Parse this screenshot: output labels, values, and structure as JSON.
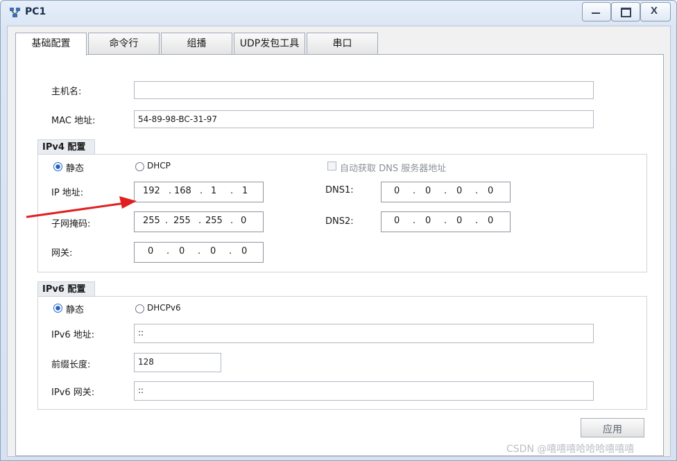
{
  "window": {
    "title": "PC1",
    "controls": {
      "minimize": "—",
      "maximize": "▭",
      "close": "X"
    }
  },
  "tabs": [
    "基础配置",
    "命令行",
    "组播",
    "UDP发包工具",
    "串口"
  ],
  "active_tab": "基础配置",
  "host": {
    "hostname_label": "主机名:",
    "hostname_value": "",
    "mac_label": "MAC 地址:",
    "mac_value": "54-89-98-BC-31-97"
  },
  "ipv4": {
    "title": "IPv4 配置",
    "static_label": "静态",
    "dhcp_label": "DHCP",
    "auto_dns_label": "自动获取 DNS 服务器地址",
    "ip_label": "IP 地址:",
    "ip": [
      "192",
      "168",
      "1",
      "1"
    ],
    "mask_label": "子网掩码:",
    "mask": [
      "255",
      "255",
      "255",
      "0"
    ],
    "gateway_label": "网关:",
    "gateway": [
      "0",
      "0",
      "0",
      "0"
    ],
    "dns1_label": "DNS1:",
    "dns1": [
      "0",
      "0",
      "0",
      "0"
    ],
    "dns2_label": "DNS2:",
    "dns2": [
      "0",
      "0",
      "0",
      "0"
    ],
    "dot": "."
  },
  "ipv6": {
    "title": "IPv6 配置",
    "static_label": "静态",
    "dhcp_label": "DHCPv6",
    "address_label": "IPv6 地址:",
    "address_value": "::",
    "prefix_label": "前缀长度:",
    "prefix_value": "128",
    "gateway_label": "IPv6 网关:",
    "gateway_value": "::"
  },
  "apply_label": "应用",
  "watermark": "CSDN @嘻嘻嘻哈哈哈嘻嘻嘻",
  "colors": {
    "accent": "#1e63c4",
    "arrow": "#e02020"
  },
  "icons": {
    "app": "network-pc-icon",
    "annotation": "red-arrow-icon"
  }
}
